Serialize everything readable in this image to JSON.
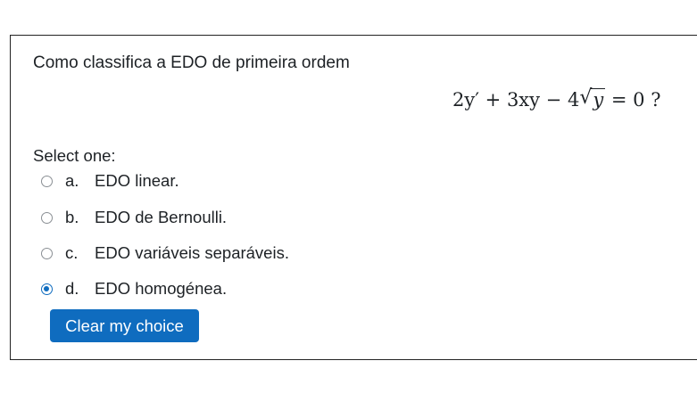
{
  "question": {
    "text": "Como classifica a EDO de primeira ordem",
    "formula": {
      "lhs_a": "2y′ + 3xy − 4",
      "radicand": "y",
      "rhs": "= 0 ?"
    }
  },
  "answer": {
    "prompt": "Select one:",
    "options": [
      {
        "letter": "a.",
        "text": "EDO linear.",
        "selected": false
      },
      {
        "letter": "b.",
        "text": "EDO de Bernoulli.",
        "selected": false
      },
      {
        "letter": "c.",
        "text": "EDO variáveis separáveis.",
        "selected": false
      },
      {
        "letter": "d.",
        "text": "EDO homogénea.",
        "selected": true
      }
    ],
    "clear_label": "Clear my choice"
  },
  "colors": {
    "accent": "#0f6cbf",
    "border": "#222222"
  }
}
